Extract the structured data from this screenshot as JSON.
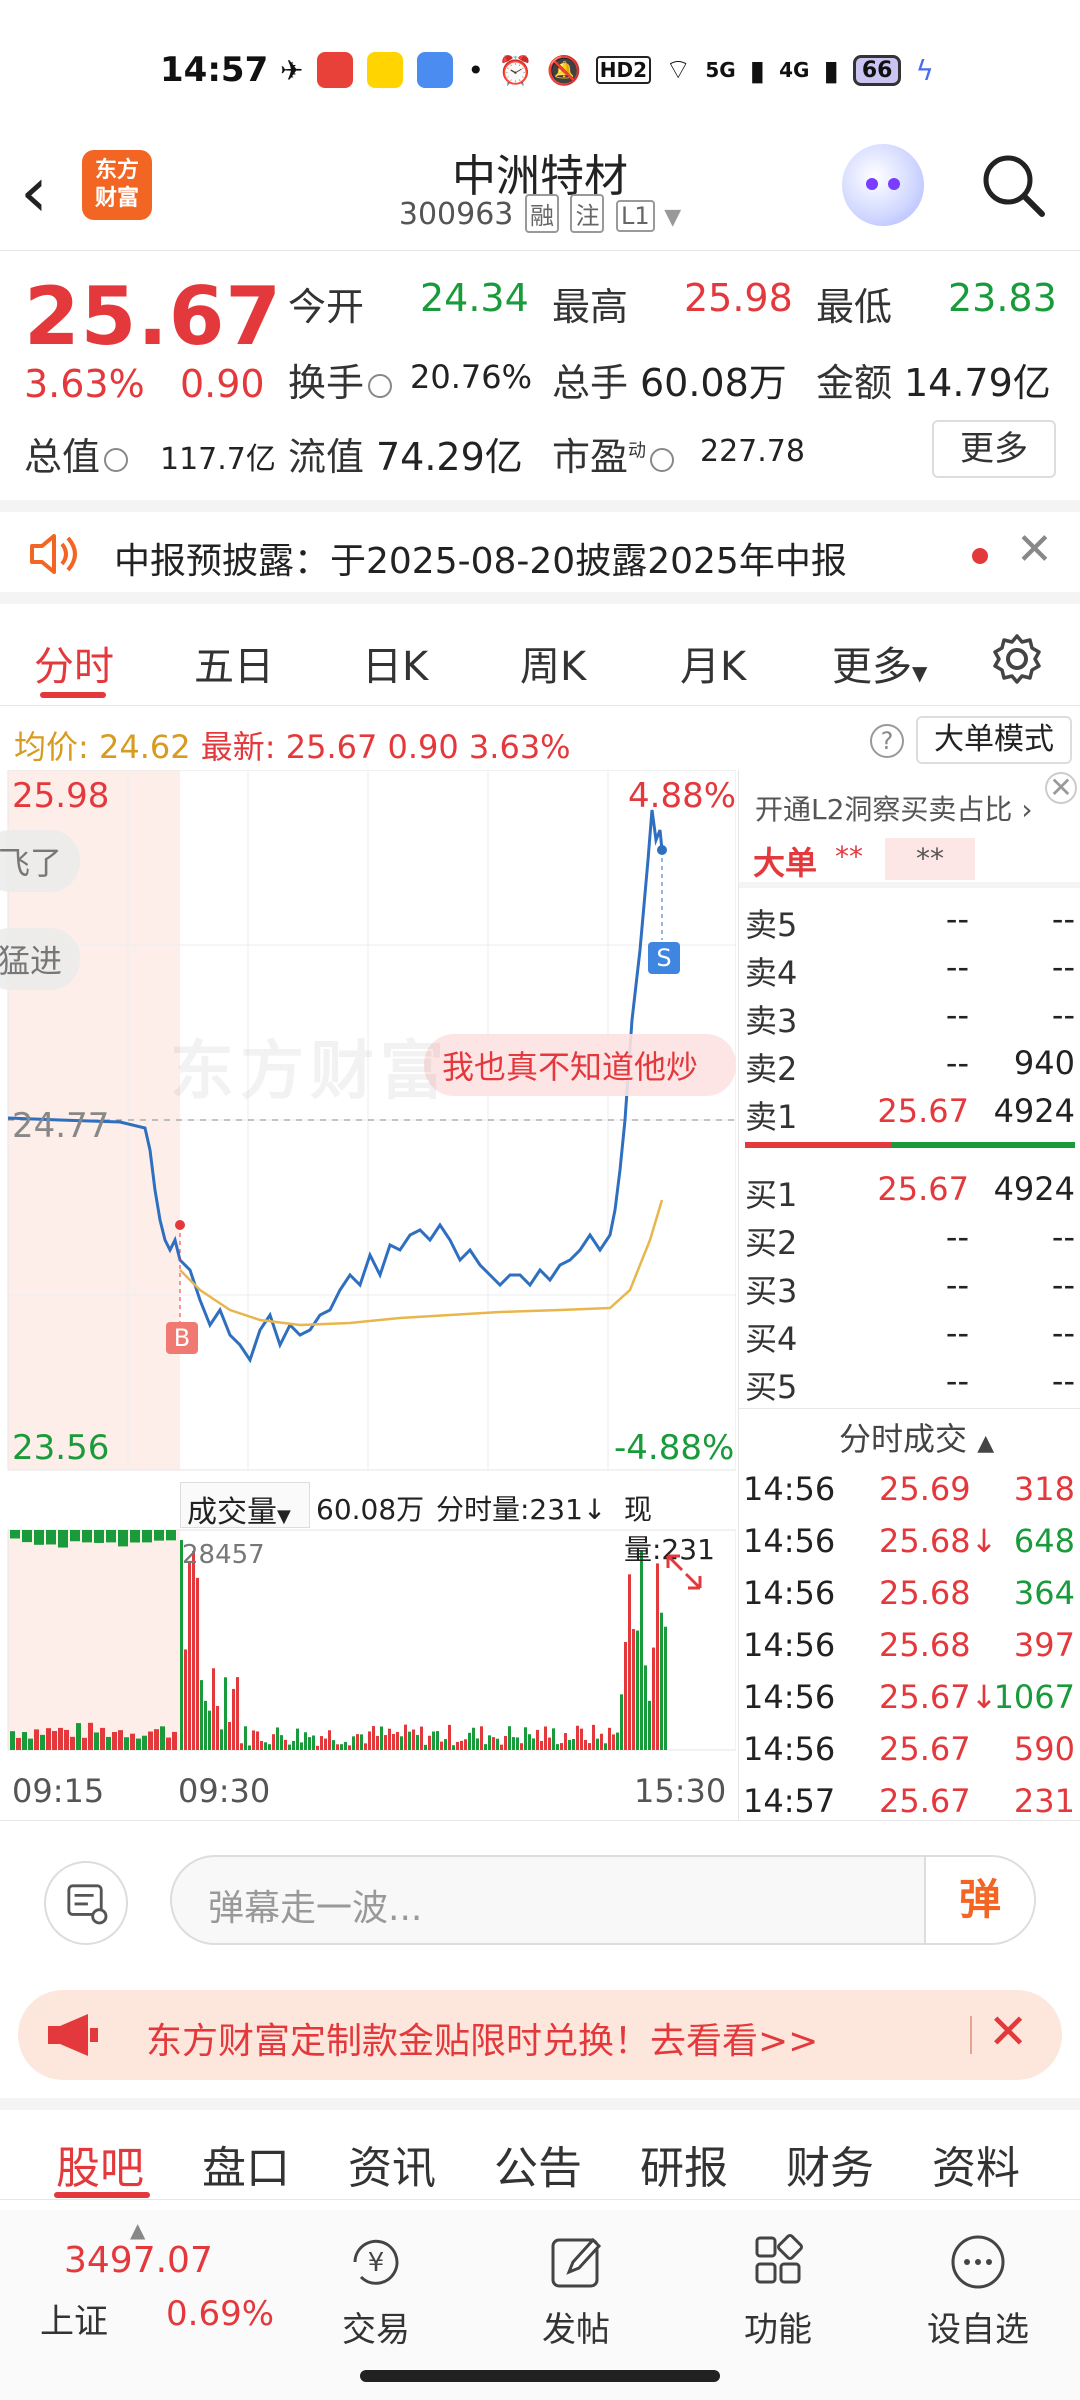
{
  "status_bar": {
    "time": "14:57",
    "hd_label": "HD2",
    "net1": "5G",
    "net2": "4G",
    "battery": "66"
  },
  "header": {
    "logo_text_line1": "东方",
    "logo_text_line2": "财富",
    "stock_name": "中洲特材",
    "stock_code": "300963",
    "tags": [
      "融",
      "注",
      "L1"
    ]
  },
  "quote": {
    "price": "25.67",
    "change_pct": "3.63%",
    "change_abs": "0.90",
    "open_label": "今开",
    "open_value": "24.34",
    "high_label": "最高",
    "high_value": "25.98",
    "low_label": "最低",
    "low_value": "23.83",
    "turnover_label": "换手",
    "turnover_value": "20.76%",
    "volume_label": "总手",
    "volume_value": "60.08万",
    "amount_label": "金额",
    "amount_value": "14.79亿",
    "mktcap_label": "总值",
    "mktcap_value": "117.7亿",
    "float_label": "流值",
    "float_value": "74.29亿",
    "pe_label": "市盈",
    "pe_sup": "动",
    "pe_value": "227.78",
    "more_label": "更多"
  },
  "notice": {
    "text": "中报预披露：于2025-08-20披露2025年中报"
  },
  "chart_tabs": [
    "分时",
    "五日",
    "日K",
    "周K",
    "月K",
    "更多"
  ],
  "info_bar": {
    "avg_label": "均价:",
    "avg_value": "24.62",
    "latest_label": "最新:",
    "latest_value": "25.67",
    "latest_chg": "0.90",
    "latest_pct": "3.63%",
    "help": "?",
    "big_mode": "大单模式"
  },
  "chart": {
    "y_max": "25.98",
    "y_min": "23.56",
    "y_mid": "24.77",
    "pct_max": "4.88%",
    "pct_min": "-4.88%",
    "watermark": "东方财富",
    "danmaku": [
      "飞了",
      "猛进",
      "我也真不知道他炒"
    ],
    "marker_b": "B",
    "marker_s": "S",
    "volume_label": "成交量",
    "volume_total": "60.08万",
    "period_vol_label": "分时量:231",
    "current_vol_label": "现量:231",
    "vol_max_label": "28457",
    "time_labels": [
      "09:15",
      "09:30",
      "15:30"
    ],
    "colors": {
      "price": "#2e6fc0",
      "avg": "#e8b64c",
      "up": "#e4393c",
      "down": "#1a9b3b"
    }
  },
  "order_book": {
    "l2_text": "开通L2洞察买卖占比",
    "big_label": "大单",
    "big_stars1": "**",
    "big_stars2": "**",
    "asks": [
      {
        "label": "卖5",
        "price": "--",
        "vol": "--"
      },
      {
        "label": "卖4",
        "price": "--",
        "vol": "--"
      },
      {
        "label": "卖3",
        "price": "--",
        "vol": "--"
      },
      {
        "label": "卖2",
        "price": "--",
        "vol": "940"
      },
      {
        "label": "卖1",
        "price": "25.67",
        "vol": "4924"
      }
    ],
    "bids": [
      {
        "label": "买1",
        "price": "25.67",
        "vol": "4924"
      },
      {
        "label": "买2",
        "price": "--",
        "vol": "--"
      },
      {
        "label": "买3",
        "price": "--",
        "vol": "--"
      },
      {
        "label": "买4",
        "price": "--",
        "vol": "--"
      },
      {
        "label": "买5",
        "price": "--",
        "vol": "--"
      }
    ],
    "ticks_title": "分时成交",
    "ticks": [
      {
        "time": "14:56",
        "price": "25.69",
        "vol": "318",
        "dir": "up"
      },
      {
        "time": "14:56",
        "price": "25.68↓",
        "vol": "648",
        "dir": "down"
      },
      {
        "time": "14:56",
        "price": "25.68",
        "vol": "364",
        "dir": "down"
      },
      {
        "time": "14:56",
        "price": "25.68",
        "vol": "397",
        "dir": "up"
      },
      {
        "time": "14:56",
        "price": "25.67↓",
        "vol": "1067",
        "dir": "down"
      },
      {
        "time": "14:56",
        "price": "25.67",
        "vol": "590",
        "dir": "up"
      },
      {
        "time": "14:57",
        "price": "25.67",
        "vol": "231",
        "dir": "up"
      }
    ]
  },
  "danmaku_input": {
    "placeholder": "弹幕走一波...",
    "send_label": "弹"
  },
  "promo": {
    "text": "东方财富定制款金贴限时兑换！去看看>>"
  },
  "sub_tabs": [
    "股吧",
    "盘口",
    "资讯",
    "公告",
    "研报",
    "财务",
    "资料"
  ],
  "toolbar": {
    "index_value": "3497.07",
    "index_name": "上证",
    "index_pct": "0.69%",
    "items": [
      "交易",
      "发帖",
      "功能",
      "设自选"
    ]
  }
}
